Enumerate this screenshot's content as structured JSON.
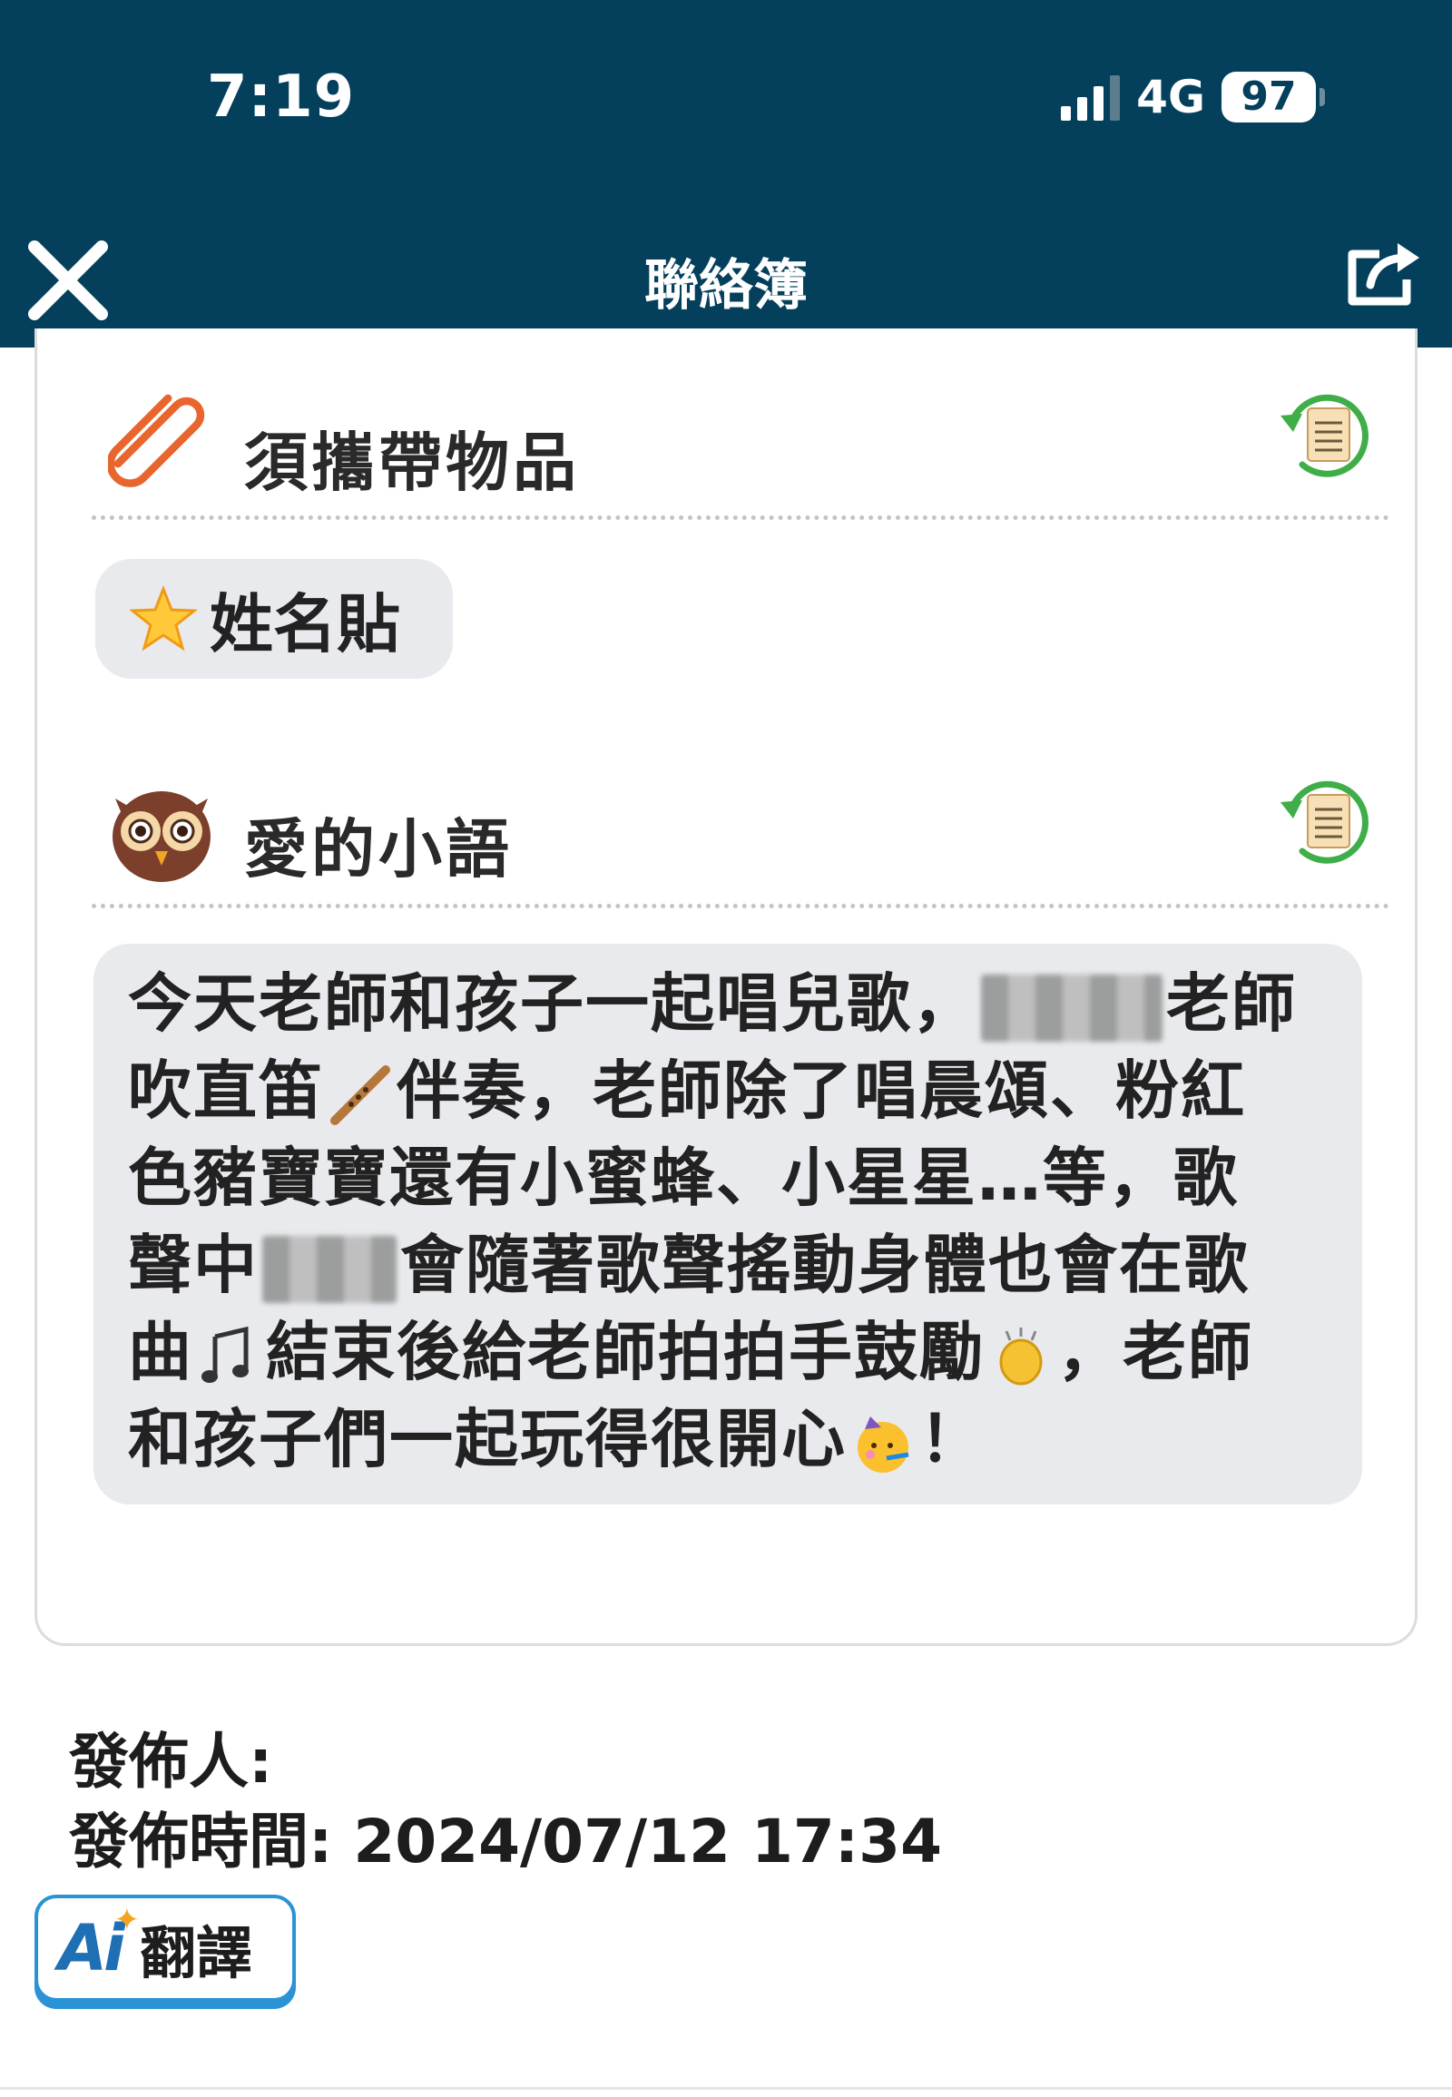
{
  "status_bar": {
    "time": "7:19",
    "network": "4G",
    "battery": "97"
  },
  "nav": {
    "title": "聯絡簿",
    "close_icon": "close-icon",
    "share_icon": "share-icon"
  },
  "items_section": {
    "title": "須攜帶物品",
    "icon": "paperclip-icon",
    "chip": {
      "emoji": "star-icon",
      "label": "姓名貼"
    }
  },
  "message_section": {
    "title": "愛的小語",
    "icon": "owl-icon",
    "lines": [
      {
        "a": "今天老師和孩子一起唱兒歌，",
        "b": "老師"
      },
      {
        "a": "吹直笛",
        "b": "伴奏，老師除了唱晨頌、粉紅"
      },
      {
        "a": "色豬寶寶還有小蜜蜂、小星星…等，歌"
      },
      {
        "a": "聲中",
        "b": "會隨著歌聲搖動身體也會在歌"
      },
      {
        "a": "曲",
        "b": "結束後給老師拍拍手鼓勵",
        "c": "，老師"
      },
      {
        "a": "和孩子們一起玩得很開心",
        "b": "！"
      }
    ]
  },
  "footer": {
    "publisher_label": "發佈人:",
    "time_label": "發佈時間: 2024/07/12 17:34",
    "translate": {
      "ai": "Ai",
      "label": "翻譯"
    }
  },
  "colors": {
    "header": "#04405c",
    "chip_bg": "#e8eaed",
    "accent_orange": "#e8662e",
    "accent_green": "#3fae49",
    "translate_border": "#2a93d6"
  }
}
